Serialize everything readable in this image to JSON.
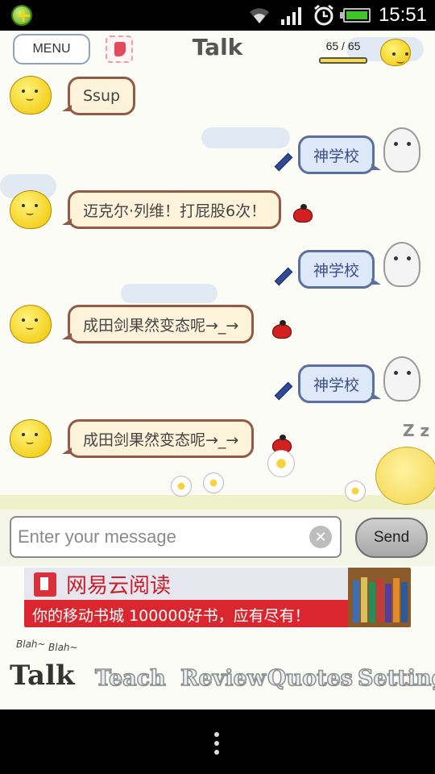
{
  "status_bar": {
    "time": "15:51",
    "icons": [
      "app-notification-icon",
      "wifi-icon",
      "signal-icon",
      "alarm-icon",
      "battery-icon"
    ]
  },
  "header": {
    "menu_label": "MENU",
    "title": "Talk",
    "counter": "65 / 65",
    "counter_fill_fraction": 1.0
  },
  "messages": [
    {
      "side": "bot",
      "text": "Ssup"
    },
    {
      "side": "user",
      "text": "神学校"
    },
    {
      "side": "bot",
      "text": "迈克尔·列维！打屁股6次！"
    },
    {
      "side": "user",
      "text": "神学校"
    },
    {
      "side": "bot",
      "text": "成田剑果然变态呢→_→"
    },
    {
      "side": "user",
      "text": "神学校"
    },
    {
      "side": "bot",
      "text": "成田剑果然变态呢→_→"
    }
  ],
  "composer": {
    "placeholder": "Enter your message",
    "value": "",
    "send_label": "Send",
    "clear_glyph": "✕"
  },
  "ad": {
    "brand": "网易云阅读",
    "text": "你的移动书城 100000好书，应有尽有！"
  },
  "tabs": {
    "blah_1": "Blah~",
    "blah_2": "Blah~",
    "items": [
      {
        "label": "Talk",
        "active": true
      },
      {
        "label": "Teach",
        "active": false
      },
      {
        "label": "Review",
        "active": false
      },
      {
        "label": "Quotes",
        "active": false
      },
      {
        "label": "Setting",
        "active": false
      }
    ]
  },
  "decor": {
    "zz": "Z z"
  }
}
